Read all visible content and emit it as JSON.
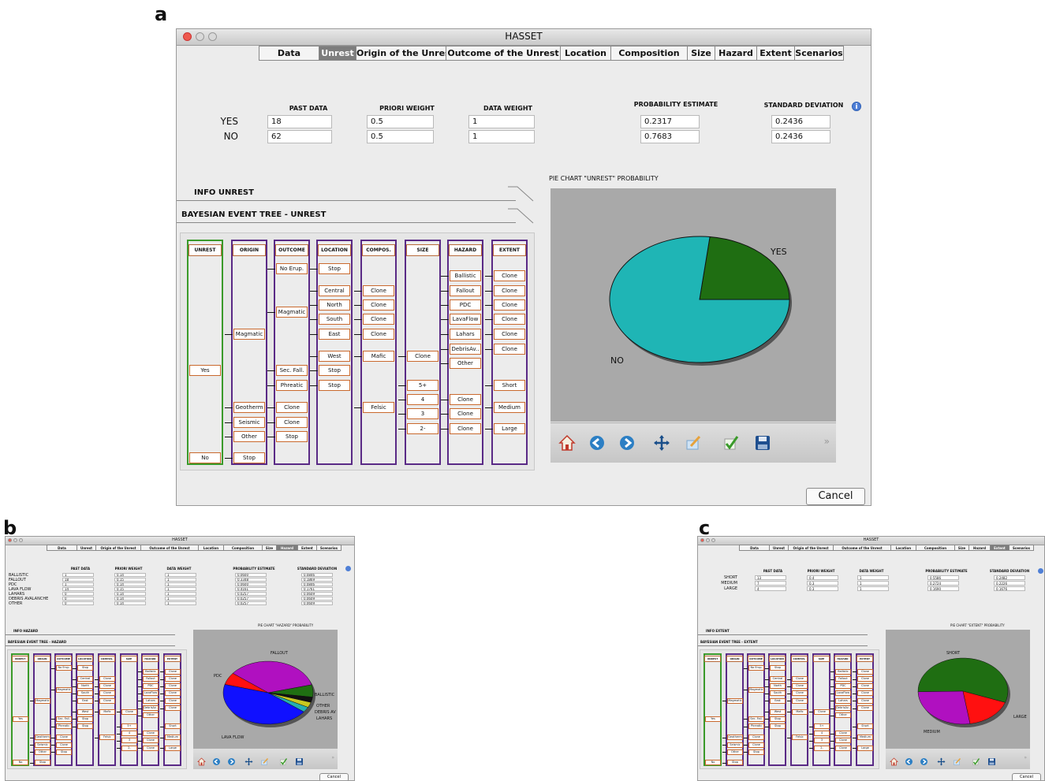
{
  "panels": {
    "a": "a",
    "b": "b",
    "c": "c"
  },
  "window_title": "HASSET",
  "tabs": [
    "Data",
    "Unrest",
    "Origin of the Unrest",
    "Outcome of the Unrest",
    "Location",
    "Composition",
    "Size",
    "Hazard",
    "Extent",
    "Scenarios"
  ],
  "cancel_label": "Cancel",
  "main": {
    "active_tab": "Unrest",
    "headers": {
      "past": "PAST DATA",
      "priori": "PRIORI WEIGHT",
      "dataw": "DATA WEIGHT",
      "prob": "PROBABILITY ESTIMATE",
      "std": "STANDARD DEVIATION"
    },
    "rows": [
      {
        "label": "YES",
        "past": "18",
        "priori": "0.5",
        "dataw": "1",
        "prob": "0.2317",
        "std": "0.2436"
      },
      {
        "label": "NO",
        "past": "62",
        "priori": "0.5",
        "dataw": "1",
        "prob": "0.7683",
        "std": "0.2436"
      }
    ],
    "info_title": "INFO UNREST",
    "tree_title": "BAYESIAN EVENT TREE - UNREST",
    "pie_title": "PIE CHART \"UNREST\" PROBABILITY",
    "pie_labels": {
      "yes": "YES",
      "no": "NO"
    }
  },
  "tree": {
    "headers": [
      "UNREST",
      "ORIGIN",
      "OUTCOME",
      "LOCATION",
      "COMPOS.",
      "SIZE",
      "HAZARD",
      "EXTENT"
    ],
    "unrest": [
      "Yes",
      "No"
    ],
    "origin": [
      "Magmatic",
      "Geotherm",
      "Seismic",
      "Other",
      "Stop"
    ],
    "outcome": [
      "No Erup.",
      "Magmatic",
      "Sec. Fall.",
      "Phreatic",
      "Clone",
      "Clone",
      "Stop"
    ],
    "location": [
      "Stop",
      "Central",
      "North",
      "South",
      "East",
      "West",
      "Stop",
      "Stop"
    ],
    "compos": [
      "Clone",
      "Clone",
      "Clone",
      "Clone",
      "Mafic",
      "Felsic"
    ],
    "size": [
      "Clone",
      "5+",
      "4",
      "3",
      "2-"
    ],
    "hazard": [
      "Ballistic",
      "Fallout",
      "PDC",
      "LavaFlow",
      "Lahars",
      "DebrisAv..",
      "Other",
      "Clone",
      "Clone",
      "Clone"
    ],
    "extent": [
      "Clone",
      "Clone",
      "Clone",
      "Clone",
      "Clone",
      "Clone",
      "Short",
      "Medium",
      "Large"
    ]
  },
  "hazard_panel": {
    "active_tab": "Hazard",
    "rows": [
      {
        "label": "BALLISTIC",
        "past": "1",
        "priori": "0.14",
        "dataw": "1",
        "prob": "0.0600",
        "std": "0.0846"
      },
      {
        "label": "FALLOUT",
        "past": "18",
        "priori": "0.15",
        "dataw": "1",
        "prob": "0.3348",
        "std": "0.1869"
      },
      {
        "label": "PDC",
        "past": "1",
        "priori": "0.14",
        "dataw": "1",
        "prob": "0.0600",
        "std": "0.0846"
      },
      {
        "label": "LAVA FLOW",
        "past": "14",
        "priori": "0.15",
        "dataw": "1",
        "prob": "0.4161",
        "std": "0.1761"
      },
      {
        "label": "LAHARS",
        "past": "0",
        "priori": "0.14",
        "dataw": "1",
        "prob": "0.0257",
        "std": "0.0609"
      },
      {
        "label": "DEBRIS AVALANCHE",
        "past": "0",
        "priori": "0.14",
        "dataw": "1",
        "prob": "0.0257",
        "std": "0.0609"
      },
      {
        "label": "OTHER",
        "past": "0",
        "priori": "0.14",
        "dataw": "1",
        "prob": "0.0257",
        "std": "0.0609"
      }
    ],
    "info_title": "INFO HAZARD",
    "tree_title": "BAYESIAN EVENT TREE - HAZARD",
    "pie_title": "PIE CHART \"HAZARD\" PROBABILITY",
    "pie_labels": {
      "fallout": "FALLOUT",
      "pdc": "PDC",
      "ballistic": "BALLISTIC",
      "other": "OTHER",
      "debris": "DEBRIS AV",
      "lahars": "LAHARS",
      "lava": "LAVA FLOW"
    }
  },
  "extent_panel": {
    "active_tab": "Extent",
    "rows": [
      {
        "label": "SHORT",
        "past": "13",
        "priori": "0.4",
        "dataw": "1",
        "prob": "0.5586",
        "std": "0.2482"
      },
      {
        "label": "MEDIUM",
        "past": "7",
        "priori": "0.3",
        "dataw": "1",
        "prob": "0.2724",
        "std": "0.2226"
      },
      {
        "label": "LARGE",
        "past": "4",
        "priori": "0.3",
        "dataw": "1",
        "prob": "0.1690",
        "std": "0.1676"
      }
    ],
    "info_title": "INFO EXTENT",
    "tree_title": "BAYESIAN EVENT TREE - EXTENT",
    "pie_title": "PIE CHART \"EXTENT\" PROBABILITY",
    "pie_labels": {
      "short": "SHORT",
      "medium": "MEDIUM",
      "large": "LARGE"
    }
  },
  "chart_data": [
    {
      "type": "pie",
      "title": "PIE CHART \"UNREST\" PROBABILITY",
      "categories": [
        "YES",
        "NO"
      ],
      "values": [
        0.2317,
        0.7683
      ],
      "colors": [
        "#1f6e12",
        "#1fb5b5"
      ]
    },
    {
      "type": "pie",
      "title": "PIE CHART \"HAZARD\" PROBABILITY",
      "categories": [
        "BALLISTIC",
        "FALLOUT",
        "PDC",
        "LAVA FLOW",
        "LAHARS",
        "DEBRIS AV",
        "OTHER"
      ],
      "values": [
        0.06,
        0.3348,
        0.06,
        0.4161,
        0.0257,
        0.0257,
        0.0257
      ],
      "colors": [
        "#1f6e12",
        "#b010c0",
        "#ff1010",
        "#1010ff",
        "#26b0b0",
        "#c8c820",
        "#111111"
      ]
    },
    {
      "type": "pie",
      "title": "PIE CHART \"EXTENT\" PROBABILITY",
      "categories": [
        "SHORT",
        "MEDIUM",
        "LARGE"
      ],
      "values": [
        0.5586,
        0.2724,
        0.169
      ],
      "colors": [
        "#1f6e12",
        "#b010c0",
        "#ff1010"
      ]
    }
  ],
  "toolbar_icons": [
    "home-icon",
    "back-arrow-icon",
    "forward-arrow-icon",
    "pan-icon",
    "edit-icon",
    "check-icon",
    "save-icon"
  ]
}
